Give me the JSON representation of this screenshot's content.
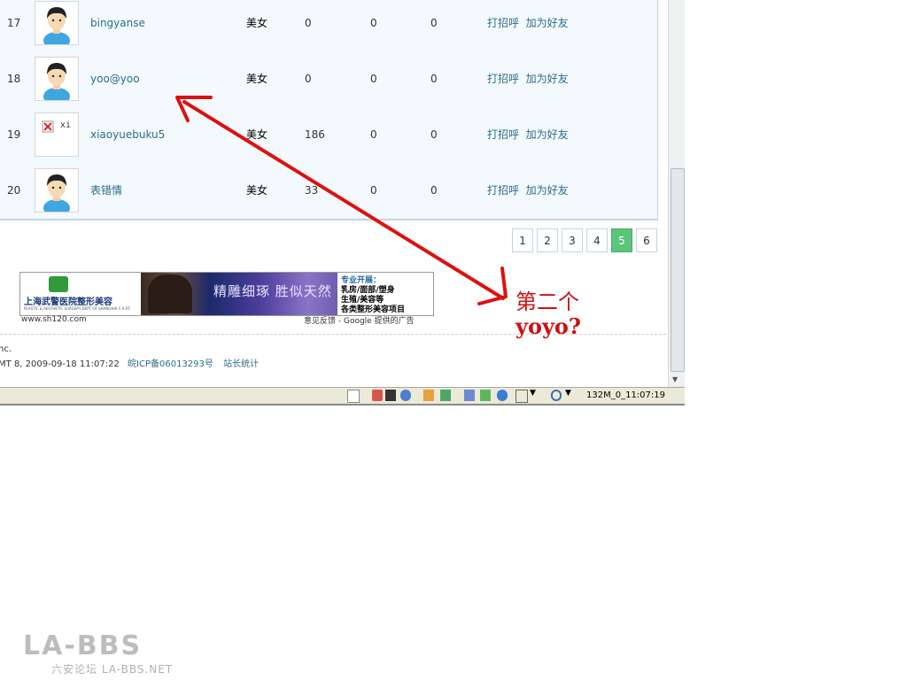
{
  "rows": [
    {
      "num": "17",
      "name": "bingyanse",
      "gender": "美女",
      "c1": "0",
      "c2": "0",
      "c3": "0",
      "avatar": "default-avatar-icon"
    },
    {
      "num": "18",
      "name": "yoo@yoo",
      "gender": "美女",
      "c1": "0",
      "c2": "0",
      "c3": "0",
      "avatar": "default-avatar-icon"
    },
    {
      "num": "19",
      "name": "xiaoyuebuku5",
      "gender": "美女",
      "c1": "186",
      "c2": "0",
      "c3": "0",
      "avatar": "broken-image-icon",
      "broken_alt": "xi"
    },
    {
      "num": "20",
      "name": "表错情",
      "gender": "美女",
      "c1": "33",
      "c2": "0",
      "c3": "0",
      "avatar": "default-avatar-icon"
    }
  ],
  "actions": {
    "greet": "打招呼",
    "add_friend": "加为好友"
  },
  "pager": {
    "pages": [
      "1",
      "2",
      "3",
      "4",
      "5",
      "6"
    ],
    "current": "5"
  },
  "ad": {
    "left_title": "上海武警医院整形美容",
    "left_sub": "PLASTIC & AESTHETIC SURGERY DEPT OF SHANGHAI C.A.P.F",
    "mid_text": "精雕细琢 胜似天然",
    "right_title": "专业开展：",
    "right_lines": [
      "乳房/面部/塑身",
      "生殖/美容等",
      "各类整形美容项目"
    ],
    "site": "www.sh120.com",
    "feedback": "意见反馈 - Google 提供的广告"
  },
  "footer": {
    "line1": "nc.",
    "line2": "MT 8, 2009-09-18 11:07:22",
    "icp": "皖ICP备06013293号",
    "stats": "站长统计"
  },
  "statusbar": {
    "text": "132M_0_11:07:19"
  },
  "annotation": {
    "line1": "第二个",
    "line2": "yoyo?"
  },
  "watermark": {
    "big": "LA-BBS",
    "small": "六安论坛 LA-BBS.NET"
  },
  "colors": {
    "link": "#2b6d8c",
    "annotation": "#cc1111",
    "pager_current": "#5bc57b",
    "border": "#c2d5e3"
  }
}
